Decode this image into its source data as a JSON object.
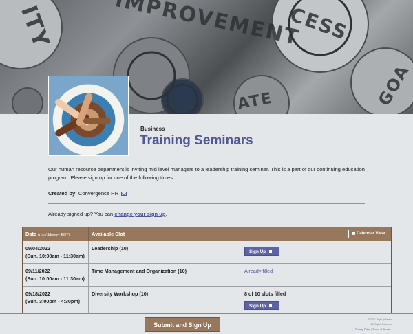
{
  "banner": {
    "words": [
      "ITY",
      "IMPROVEMENT",
      "CESS",
      "GOA",
      "ATE"
    ]
  },
  "header": {
    "category": "Business",
    "title": "Training Seminars"
  },
  "description": "Our human resource department is inviting mid level managers to a leadership training seminar.  This is a part of our continuing education program.  Please sign up for one of the following times.",
  "created_by": {
    "label": "Created by:",
    "name": "Convergence HR"
  },
  "already": {
    "prefix": "Already signed up? You can ",
    "link": "change your sign up",
    "suffix": "."
  },
  "table": {
    "col_date": "Date",
    "col_date_format": "(mm/dd/yyyy EDT)",
    "col_slot": "Available Slot",
    "calendar_view": "Calendar View",
    "rows": [
      {
        "date": "09/04/2022",
        "time": "(Sun. 10:00am - 11:30am)",
        "slot": "Leadership (10)",
        "status": "",
        "button": "Sign Up"
      },
      {
        "date": "09/11/2022",
        "time": "(Sun. 10:00am - 11:30am)",
        "slot": "Time Management and Organization (10)",
        "status": "Already filled",
        "button": ""
      },
      {
        "date": "09/18/2022",
        "time": "(Sun. 3:00pm - 4:30pm)",
        "slot": "Diversity Workshop (10)",
        "status": "8 of 10 slots filled",
        "button": "Sign Up"
      }
    ]
  },
  "footer": {
    "submit": "Submit and Sign Up",
    "copyright": "©2021 SignUpGenius",
    "rights": "All Rights Reserved",
    "privacy": "Privacy Policy",
    "sep": " | ",
    "terms": "Terms of Service",
    "end": " |"
  },
  "colors": {
    "accent": "#4f5796",
    "header_brown": "#98785d",
    "button_blue": "#5e63a6",
    "background": "#e3e7ea"
  }
}
